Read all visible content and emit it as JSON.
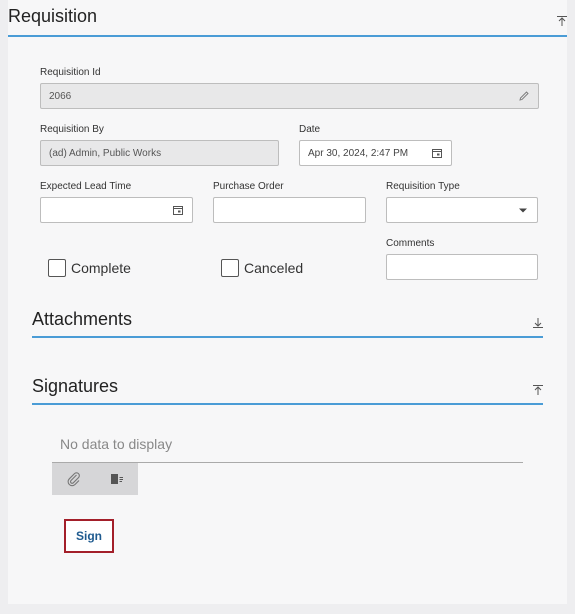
{
  "requisition": {
    "title": "Requisition",
    "id_label": "Requisition Id",
    "id_value": "2066",
    "by_label": "Requisition By",
    "by_value": "(ad) Admin, Public Works",
    "date_label": "Date",
    "date_value": "Apr 30, 2024, 2:47 PM",
    "lead_time_label": "Expected Lead Time",
    "lead_time_value": "",
    "po_label": "Purchase Order",
    "po_value": "",
    "type_label": "Requisition Type",
    "type_value": "",
    "complete_label": "Complete",
    "complete_checked": false,
    "canceled_label": "Canceled",
    "canceled_checked": false,
    "comments_label": "Comments",
    "comments_value": ""
  },
  "attachments": {
    "title": "Attachments"
  },
  "signatures": {
    "title": "Signatures",
    "empty_text": "No data to display",
    "sign_label": "Sign"
  },
  "icons": {
    "collapse": "collapse-up-icon",
    "expand": "expand-down-icon",
    "edit": "pencil-icon",
    "calendar": "calendar-icon",
    "dropdown": "caret-down-icon",
    "attach": "paperclip-icon",
    "columns": "column-chooser-icon"
  },
  "colors": {
    "accent": "#4a9cd6",
    "sign_border": "#a31f2a",
    "sign_text": "#1e5a8f"
  }
}
